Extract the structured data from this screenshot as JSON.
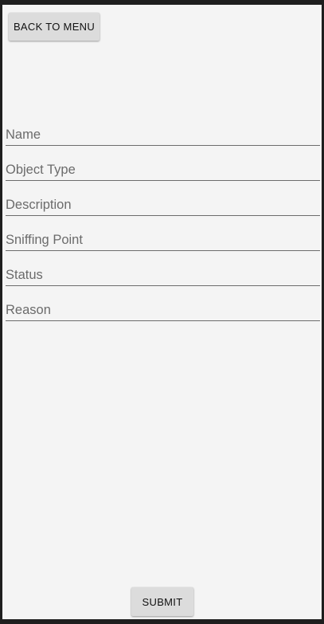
{
  "toolbar": {
    "back_label": "BACK TO MENU"
  },
  "form": {
    "fields": [
      {
        "placeholder": "Name",
        "value": ""
      },
      {
        "placeholder": "Object Type",
        "value": ""
      },
      {
        "placeholder": "Description",
        "value": ""
      },
      {
        "placeholder": "Sniffing Point",
        "value": ""
      },
      {
        "placeholder": "Status",
        "value": ""
      },
      {
        "placeholder": "Reason",
        "value": ""
      }
    ],
    "submit_label": "SUBMIT"
  },
  "colors": {
    "background": "#f4f4f4",
    "button": "#dcdcdc",
    "underline": "#6c6c6c",
    "frame": "#1e1e1e"
  }
}
